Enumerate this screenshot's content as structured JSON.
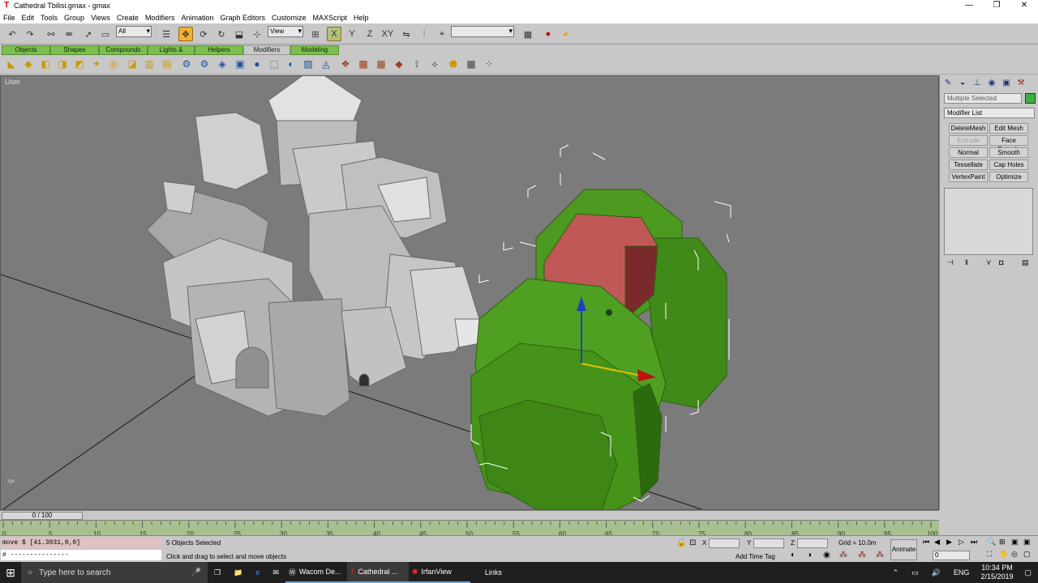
{
  "window": {
    "title": "Cathedral Tbilisi.gmax - gmax"
  },
  "menu": [
    "File",
    "Edit",
    "Tools",
    "Group",
    "Views",
    "Create",
    "Modifiers",
    "Animation",
    "Graph Editors",
    "Customize",
    "MAXScript",
    "Help"
  ],
  "toolbar": {
    "selection_filter": "All",
    "ref_coord": "View",
    "named_selection": ""
  },
  "tabs": [
    "Objects",
    "Shapes",
    "Compounds",
    "Lights & Cameras",
    "Helpers",
    "Modifiers",
    "Modeling"
  ],
  "active_tab": "Modifiers",
  "viewport": {
    "label": "User",
    "axis_labels": [
      "z",
      "y",
      "x"
    ]
  },
  "command_panel": {
    "name_field": "Multiple Selected",
    "modifier_list": "Modifier List",
    "object_color": "#3cb03c",
    "buttons": [
      "DeleteMesh",
      "Edit Mesh",
      "Extrude",
      "Face Extrude",
      "Normal",
      "Smooth",
      "Tessellate",
      "Cap Holes",
      "VertexPaint",
      "Optimize"
    ],
    "disabled": [
      "Extrude"
    ]
  },
  "timeline": {
    "slider_label": "0 / 100",
    "ticks": [
      "0",
      "5",
      "10",
      "15",
      "20",
      "25",
      "30",
      "35",
      "40",
      "45",
      "50",
      "55",
      "60",
      "65",
      "70",
      "75",
      "80",
      "85",
      "90",
      "95",
      "100"
    ]
  },
  "status": {
    "listener_input": "move $ [41.3031,0,0]",
    "listener_output": "# ---------------",
    "selection_text": "5 Objects Selected",
    "prompt_text": "Click and drag to select and move objects",
    "x_label": "X",
    "y_label": "Y",
    "z_label": "Z",
    "grid": "Grid = 10.0m",
    "add_time_tag": "Add Time Tag",
    "animate": "Animate",
    "frame": "0"
  },
  "taskbar": {
    "search_placeholder": "Type here to search",
    "apps": [
      "Wacom De...",
      "Cathedral ...",
      "IrfanView"
    ],
    "links": "Links",
    "lang": "ENG",
    "time": "10:34 PM",
    "date": "2/15/2019"
  }
}
